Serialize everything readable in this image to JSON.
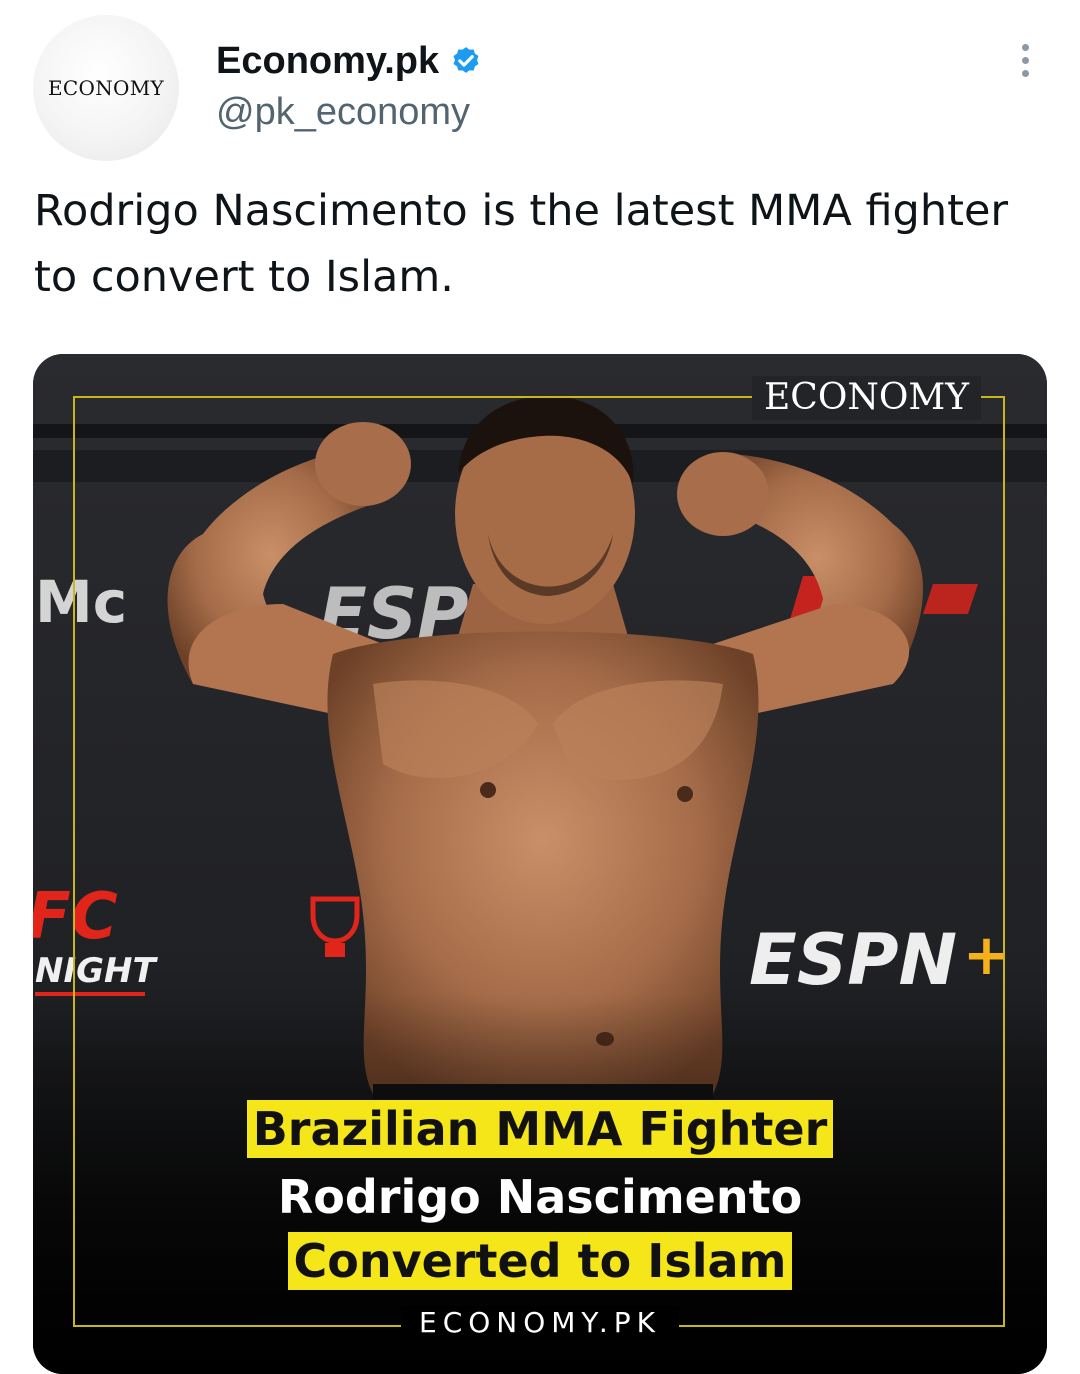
{
  "author": {
    "avatar_text": "ECONOMY",
    "display_name": "Economy.pk",
    "handle": "@pk_economy",
    "verified": true
  },
  "tweet": {
    "text": "Rodrigo Nascimento is the latest MMA fighter to convert to Islam."
  },
  "media": {
    "brand_top": "ECONOMY",
    "headline_line1": "Brazilian MMA Fighter",
    "headline_line2": "Rodrigo Nascimento",
    "headline_line3": "Converted to Islam",
    "brand_bottom": "ECONOMY.PK",
    "background_text": {
      "esp_top": "ESP",
      "espn_plus": "ESPN",
      "night": "NIGHT",
      "fc": "FC",
      "mc": "Mc"
    }
  },
  "icons": {
    "verified": "verified-badge-icon",
    "more": "more-options-icon"
  },
  "colors": {
    "accent_yellow": "#f5e61a",
    "frame_gold": "#c9b51c",
    "verified_blue": "#1d9bf0",
    "handle_gray": "#536471",
    "espn_red": "#e1251b"
  }
}
